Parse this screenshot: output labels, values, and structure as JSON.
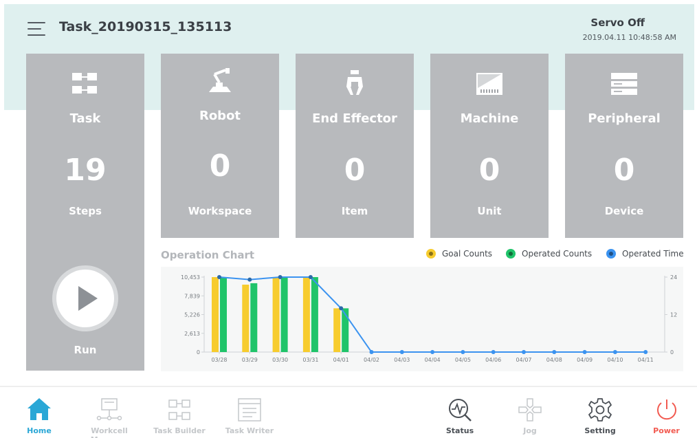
{
  "header": {
    "task_name": "Task_20190315_135113",
    "servo_status": "Servo Off",
    "datetime": "2019.04.11 10:48:58 AM"
  },
  "cards": {
    "task": {
      "label": "Task",
      "count": "19",
      "unit": "Steps",
      "run_label": "Run"
    },
    "robot": {
      "label": "Robot",
      "count": "0",
      "unit": "Workspace"
    },
    "end_effector": {
      "label": "End Effector",
      "count": "0",
      "unit": "Item"
    },
    "machine": {
      "label": "Machine",
      "count": "0",
      "unit": "Unit"
    },
    "peripheral": {
      "label": "Peripheral",
      "count": "0",
      "unit": "Device"
    }
  },
  "chart_title": "Operation Chart",
  "legend": {
    "goal": "Goal Counts",
    "operated": "Operated Counts",
    "time": "Operated Time"
  },
  "colors": {
    "goal": "#f7cc2e",
    "operated": "#20c46a",
    "time": "#3b93f0",
    "card": "#b8babd",
    "header": "#dff0ef",
    "nav_active": "#2aa7d6",
    "nav_inactive": "#c4c7ca",
    "nav_dark": "#4a4f55",
    "power": "#f25a50"
  },
  "chart_data": {
    "type": "bar",
    "categories": [
      "03/28",
      "03/29",
      "03/30",
      "03/31",
      "04/01",
      "04/02",
      "04/03",
      "04/04",
      "04/05",
      "04/06",
      "04/07",
      "04/08",
      "04/09",
      "04/10",
      "04/11"
    ],
    "series": [
      {
        "name": "Goal Counts",
        "type": "bar",
        "axis": "left",
        "values": [
          10453,
          9400,
          10453,
          10453,
          6100,
          0,
          0,
          0,
          0,
          0,
          0,
          0,
          0,
          0,
          0
        ]
      },
      {
        "name": "Operated Counts",
        "type": "bar",
        "axis": "left",
        "values": [
          10453,
          9600,
          10453,
          10453,
          6100,
          0,
          0,
          0,
          0,
          0,
          0,
          0,
          0,
          0,
          0
        ]
      },
      {
        "name": "Operated Time",
        "type": "line",
        "axis": "right",
        "values": [
          24,
          23.2,
          24,
          24,
          14,
          0,
          0,
          0,
          0,
          0,
          0,
          0,
          0,
          0,
          0
        ]
      }
    ],
    "y_left_ticks": [
      "0",
      "2,613",
      "5,226",
      "7,839",
      "10,453"
    ],
    "y_left_lim": [
      0,
      10453
    ],
    "y_right_ticks": [
      "0",
      "12",
      "24"
    ],
    "y_right_lim": [
      0,
      24
    ],
    "legend_position": "top-right",
    "grid": false
  },
  "nav": {
    "home": {
      "label": "Home",
      "icon": "home-icon",
      "state": "active"
    },
    "workcell": {
      "label": "Workcell Manager",
      "icon": "workcell-icon",
      "state": "disabled"
    },
    "task_builder": {
      "label": "Task Builder",
      "icon": "task-builder-icon",
      "state": "disabled"
    },
    "task_writer": {
      "label": "Task Writer",
      "icon": "task-writer-icon",
      "state": "disabled"
    },
    "status": {
      "label": "Status",
      "icon": "status-icon",
      "state": "enabled"
    },
    "jog": {
      "label": "Jog",
      "icon": "jog-icon",
      "state": "disabled"
    },
    "setting": {
      "label": "Setting",
      "icon": "gear-icon",
      "state": "enabled"
    },
    "power": {
      "label": "Power",
      "icon": "power-icon",
      "state": "enabled"
    }
  }
}
